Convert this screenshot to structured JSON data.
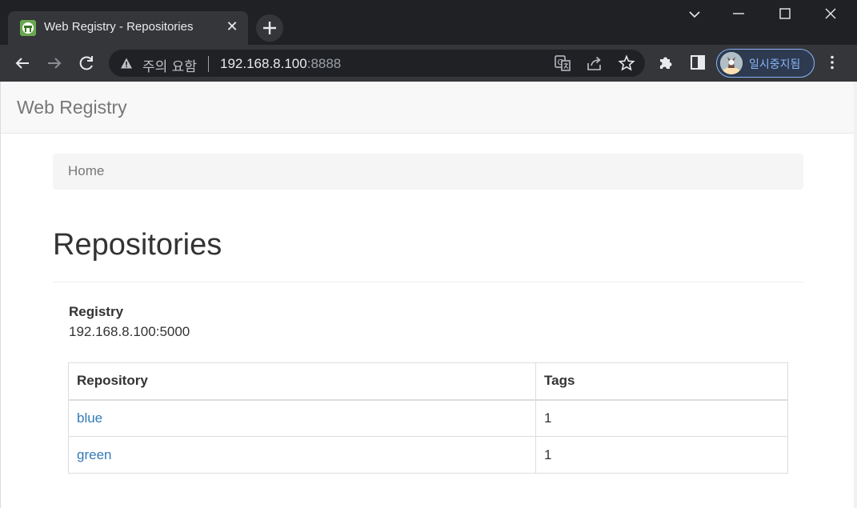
{
  "browser": {
    "tab": {
      "title": "Web Registry - Repositories"
    },
    "address": {
      "security_label": "주의 요함",
      "host": "192.168.8.100",
      "port": ":8888"
    },
    "profile": {
      "label": "일시중지됨"
    }
  },
  "navbar": {
    "brand": "Web Registry"
  },
  "breadcrumb": {
    "items": [
      "Home"
    ]
  },
  "page": {
    "title": "Repositories",
    "registry_label": "Registry",
    "registry_value": "192.168.8.100:5000"
  },
  "table": {
    "headers": [
      "Repository",
      "Tags"
    ],
    "rows": [
      {
        "repository": "blue",
        "tags": "1"
      },
      {
        "repository": "green",
        "tags": "1"
      }
    ]
  },
  "colors": {
    "link": "#337ab7",
    "chrome_dark": "#202124",
    "chrome_toolbar": "#35363a",
    "navbar_bg": "#f8f8f8",
    "breadcrumb_bg": "#f5f5f5",
    "accent_profile": "#8ab4f8"
  },
  "icons": {
    "favicon": "registry-favicon-icon",
    "back": "arrow-left-icon",
    "forward": "arrow-right-icon",
    "reload": "reload-icon",
    "warning": "warning-triangle-icon",
    "translate": "translate-icon",
    "share": "share-icon",
    "bookmark": "star-icon",
    "extensions": "puzzle-icon",
    "side_panel": "side-panel-icon",
    "menu": "kebab-menu-icon"
  }
}
